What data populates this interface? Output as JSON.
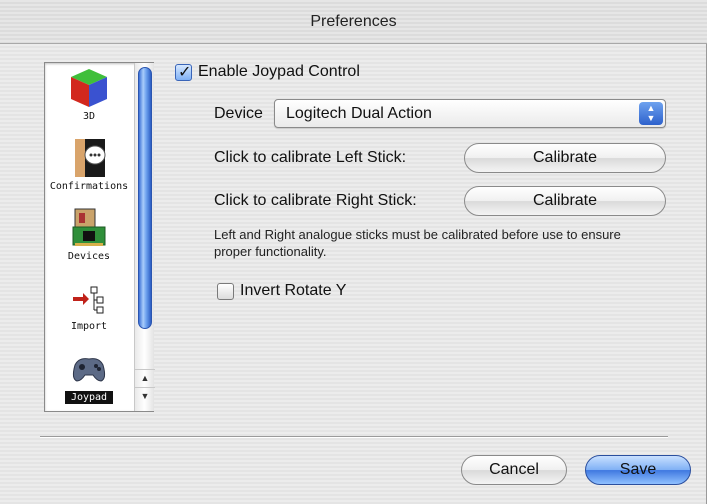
{
  "window": {
    "title": "Preferences"
  },
  "sidebar": {
    "items": [
      {
        "label": "3D",
        "icon": "cube-icon"
      },
      {
        "label": "Confirmations",
        "icon": "speech-bubble-icon"
      },
      {
        "label": "Devices",
        "icon": "circuit-board-icon"
      },
      {
        "label": "Import",
        "icon": "import-tree-icon"
      },
      {
        "label": "Joypad",
        "icon": "gamepad-icon",
        "selected": true
      }
    ]
  },
  "joypad": {
    "enable_label": "Enable Joypad Control",
    "enable_checked": true,
    "device_label": "Device",
    "device_value": "Logitech Dual Action",
    "left_stick_label": "Click to calibrate Left Stick:",
    "right_stick_label": "Click to calibrate Right Stick:",
    "calibrate_label": "Calibrate",
    "help_text": "Left and Right analogue sticks must be calibrated before use to ensure proper functionality.",
    "invert_label": "Invert Rotate Y",
    "invert_checked": false
  },
  "footer": {
    "cancel_label": "Cancel",
    "save_label": "Save"
  },
  "colors": {
    "accent": "#3f78e0",
    "selection": "#111111"
  }
}
